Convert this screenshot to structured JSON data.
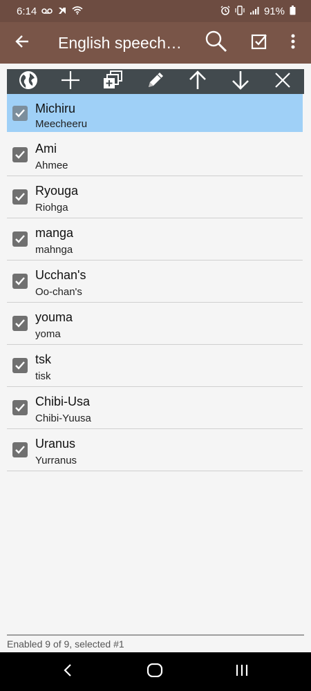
{
  "status_bar": {
    "time": "6:14",
    "battery": "91%",
    "icons_left": [
      "voicemail-icon",
      "notification-icon",
      "wifi-icon"
    ],
    "icons_right": [
      "alarm-icon",
      "vibrate-icon",
      "signal-icon",
      "battery-icon"
    ]
  },
  "app_bar": {
    "title": "English speech…",
    "actions": [
      "back-icon",
      "search-icon",
      "select-all-icon",
      "overflow-menu-icon"
    ]
  },
  "toolbar": {
    "buttons": [
      "globe-icon",
      "add-icon",
      "copy-icon",
      "edit-icon",
      "move-up-icon",
      "move-down-icon",
      "delete-icon"
    ]
  },
  "items": [
    {
      "name": "Michiru",
      "pron": "Meecheeru",
      "checked": true,
      "selected": true
    },
    {
      "name": "Ami",
      "pron": "Ahmee",
      "checked": true
    },
    {
      "name": "Ryouga",
      "pron": "Riohga",
      "checked": true
    },
    {
      "name": "manga",
      "pron": "mahnga",
      "checked": true
    },
    {
      "name": "Ucchan's",
      "pron": "Oo-chan's",
      "checked": true
    },
    {
      "name": "youma",
      "pron": "yoma",
      "checked": true
    },
    {
      "name": "tsk",
      "pron": "tisk",
      "checked": true
    },
    {
      "name": "Chibi-Usa",
      "pron": "Chibi-Yuusa",
      "checked": true
    },
    {
      "name": "Uranus",
      "pron": "Yurranus",
      "checked": true
    }
  ],
  "footer": {
    "status": "Enabled 9 of 9, selected #1"
  },
  "colors": {
    "status_bar": "#6d4c41",
    "app_bar": "#795548",
    "toolbar": "#424a4e",
    "selected_row": "#9fd0f7",
    "checkbox": "#707070"
  }
}
